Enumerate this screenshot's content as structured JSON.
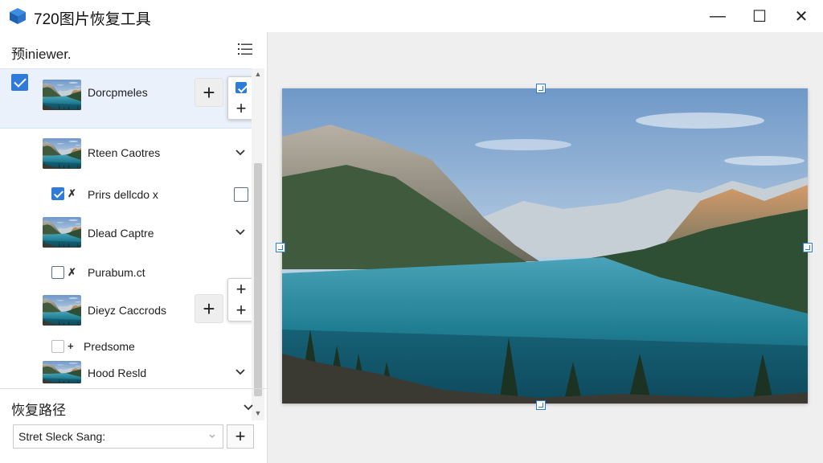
{
  "window": {
    "title": "720图片恢复工具",
    "controls": {
      "minimize": "—",
      "maximize": "☐",
      "close": "✕"
    }
  },
  "sidebar": {
    "title": "预iniewer.",
    "items": [
      {
        "label": "Dorcpmeles",
        "checked": true
      },
      {
        "label": "Rteen Caotres"
      },
      {
        "label": "Prirs dellcdo x"
      },
      {
        "label": "Dlead Captre"
      },
      {
        "label": "Purabum.ct"
      },
      {
        "label": "Dieyz Caccrods"
      },
      {
        "label": "Predsome"
      },
      {
        "label": "Hood Resld"
      }
    ],
    "plus": "+"
  },
  "recovery_path": {
    "title": "恢复路径",
    "input_value": "Stret Sleck Sang:",
    "add": "+"
  },
  "colors": {
    "accent": "#2f7bd9",
    "selected_bg": "#eaf1fb",
    "preview_bg": "#efefef"
  },
  "icons": [
    "app-logo-icon",
    "list-view-icon",
    "chevron-down-icon",
    "plus-icon",
    "resize-handle-icon",
    "close-icon",
    "maximize-icon",
    "minimize-icon"
  ]
}
